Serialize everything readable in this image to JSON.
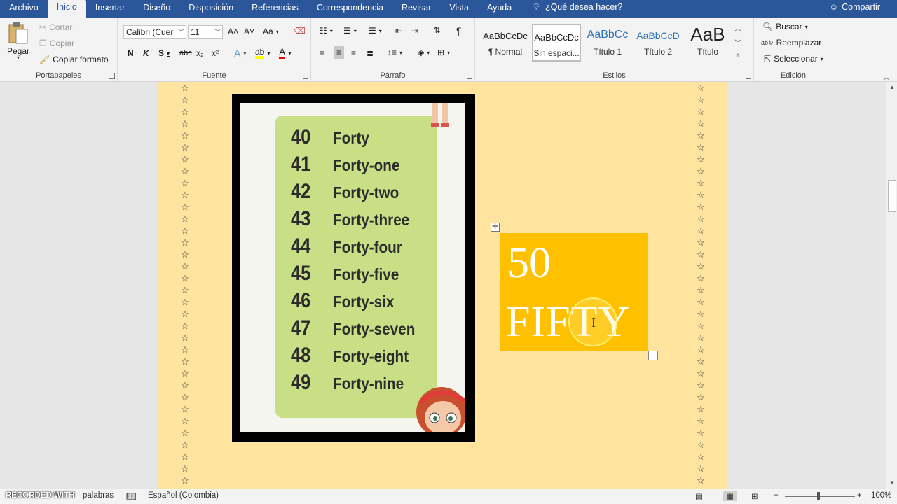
{
  "menu": {
    "tabs": [
      "Archivo",
      "Inicio",
      "Insertar",
      "Diseño",
      "Disposición",
      "Referencias",
      "Correspondencia",
      "Revisar",
      "Vista",
      "Ayuda"
    ],
    "tell_me": "¿Qué desea hacer?",
    "share": "Compartir"
  },
  "clipboard": {
    "paste": "Pegar",
    "cut": "Cortar",
    "copy": "Copiar",
    "format_painter": "Copiar formato",
    "label": "Portapapeles"
  },
  "font": {
    "name": "Calibri (Cuer",
    "size": "11",
    "bold": "N",
    "italic": "K",
    "underline": "S",
    "strike": "abc",
    "sub": "x₂",
    "sup": "x²",
    "grow": "A˄",
    "shrink": "A˅",
    "case": "Aa",
    "label": "Fuente"
  },
  "paragraph": {
    "label": "Párrafo"
  },
  "styles": {
    "items": [
      {
        "sample": "AaBbCcDc",
        "name": "¶ Normal"
      },
      {
        "sample": "AaBbCcDc",
        "name": "Sin espaci..."
      },
      {
        "sample": "AaBbCc",
        "name": "Título 1"
      },
      {
        "sample": "AaBbCcD",
        "name": "Título 2"
      },
      {
        "sample": "AaB",
        "name": "Título"
      }
    ],
    "label": "Estilos"
  },
  "editing": {
    "find": "Buscar",
    "replace": "Reemplazar",
    "select": "Seleccionar",
    "label": "Edición"
  },
  "document": {
    "star": "☆",
    "numbers": [
      {
        "n": "40",
        "w": "Forty"
      },
      {
        "n": "41",
        "w": "Forty-one"
      },
      {
        "n": "42",
        "w": "Forty-two"
      },
      {
        "n": "43",
        "w": "Forty-three"
      },
      {
        "n": "44",
        "w": "Forty-four"
      },
      {
        "n": "45",
        "w": "Forty-five"
      },
      {
        "n": "46",
        "w": "Forty-six"
      },
      {
        "n": "47",
        "w": "Forty-seven"
      },
      {
        "n": "48",
        "w": "Forty-eight"
      },
      {
        "n": "49",
        "w": "Forty-nine"
      }
    ],
    "textbox_number": "50",
    "textbox_word": "FIFTY",
    "page_color": "#ffe49f",
    "textbox_color": "#ffc000"
  },
  "status": {
    "watermark": "RECORDED WITH",
    "words": "palabras",
    "language": "Español (Colombia)",
    "zoom": "100%"
  }
}
